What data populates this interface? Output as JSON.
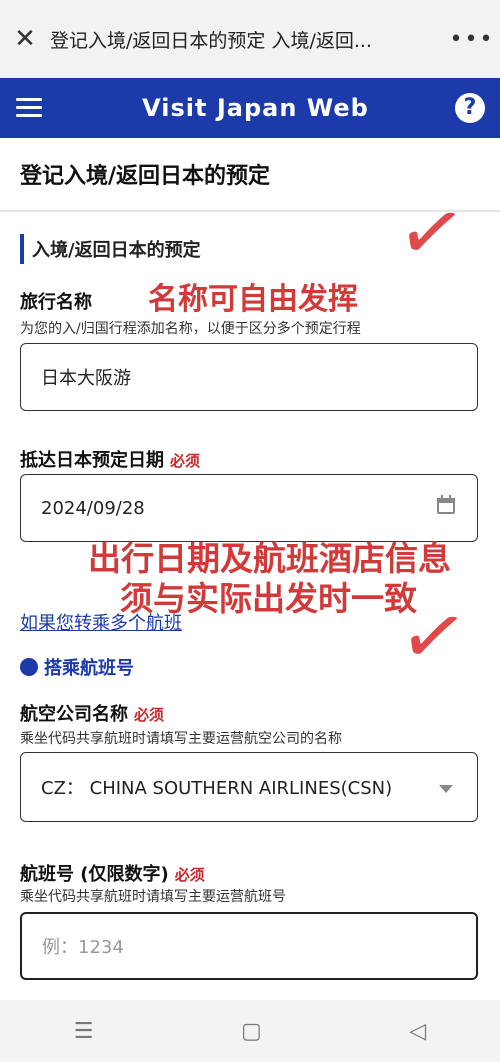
{
  "browser": {
    "title": "登记入境/返回日本的预定 入境/返回...",
    "close_icon": "✕",
    "more_icon": "•••"
  },
  "app": {
    "title": "Visit Japan Web",
    "help_icon": "?"
  },
  "page": {
    "title": "登记入境/返回日本的预定"
  },
  "section": {
    "header": "入境/返回日本的预定"
  },
  "trip_name": {
    "label": "旅行名称",
    "hint": "为您的入/归国行程添加名称，以便于区分多个预定行程",
    "value": "日本大阪游"
  },
  "arrival_date": {
    "label": "抵达日本预定日期",
    "required": "必须",
    "value": "2024/09/28"
  },
  "transfer_link": "如果您转乘多个航班",
  "flight_section": {
    "title": "搭乘航班号"
  },
  "airline": {
    "label": "航空公司名称",
    "required": "必须",
    "hint": "乘坐代码共享航班时请填写主要运营航空公司的名称",
    "value": "CZ：  CHINA SOUTHERN AIRLINES(CSN)"
  },
  "flight_no": {
    "label": "航班号 (仅限数字)",
    "required": "必须",
    "hint": "乘坐代码共享航班时请填写主要运营航班号",
    "placeholder": "例：1234"
  },
  "annotations": {
    "note1": "名称可自由发挥",
    "note2": "出行日期及航班酒店信息",
    "note3": "须与实际出发时一致",
    "check": "✓"
  },
  "bottom_nav": {
    "menu_icon": "☰",
    "home_icon": "▢",
    "back_icon": "◁"
  },
  "colors": {
    "brand": "#1c3aa9",
    "required": "#c9272b",
    "annotation": "#d23a3a"
  }
}
